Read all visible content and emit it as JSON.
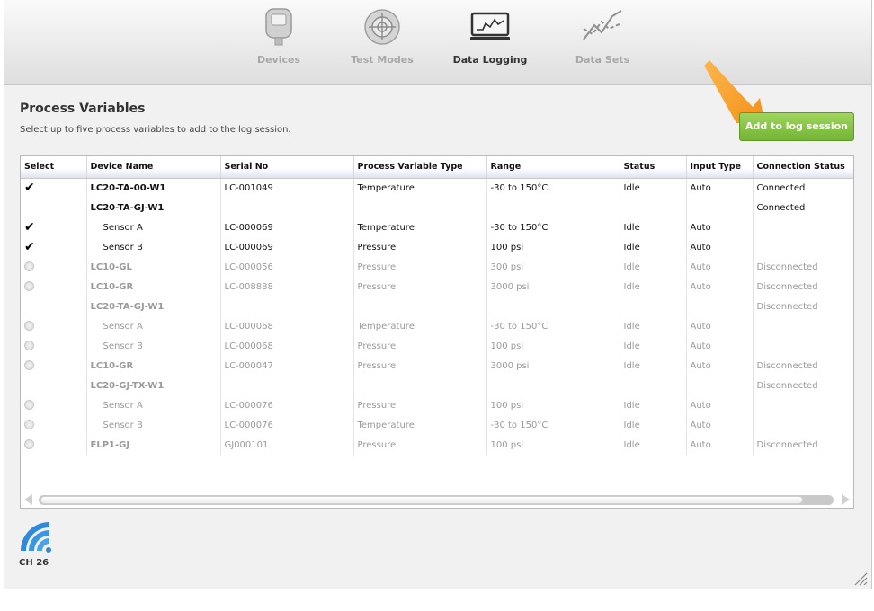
{
  "nav": {
    "items": [
      {
        "label": "Devices",
        "icon": "device-icon",
        "active": false
      },
      {
        "label": "Test Modes",
        "icon": "crosshair-icon",
        "active": false
      },
      {
        "label": "Data Logging",
        "icon": "monitor-chart-icon",
        "active": true
      },
      {
        "label": "Data Sets",
        "icon": "line-chart-icon",
        "active": false
      }
    ]
  },
  "main": {
    "title": "Process Variables",
    "subtitle": "Select up to five process variables to add to the log session.",
    "add_button": "Add to log session"
  },
  "table": {
    "headers": [
      "Select",
      "Device Name",
      "Serial No",
      "Process Variable Type",
      "Range",
      "Status",
      "Input Type",
      "Connection Status"
    ],
    "rows": [
      {
        "select": "check",
        "device": "LC20-TA-00-W1",
        "level": "device",
        "serial": "LC-001049",
        "type": "Temperature",
        "range": "-30 to 150°C",
        "status": "Idle",
        "input": "Auto",
        "conn": "Connected",
        "disabled": false
      },
      {
        "select": "none",
        "device": "LC20-TA-GJ-W1",
        "level": "device",
        "serial": "",
        "type": "",
        "range": "",
        "status": "",
        "input": "",
        "conn": "Connected",
        "disabled": false
      },
      {
        "select": "check",
        "device": "Sensor A",
        "level": "sensor",
        "serial": "LC-000069",
        "type": "Temperature",
        "range": "-30 to 150°C",
        "status": "Idle",
        "input": "Auto",
        "conn": "",
        "disabled": false
      },
      {
        "select": "check",
        "device": "Sensor B",
        "level": "sensor",
        "serial": "LC-000069",
        "type": "Pressure",
        "range": "100 psi",
        "status": "Idle",
        "input": "Auto",
        "conn": "",
        "disabled": false
      },
      {
        "select": "radio",
        "device": "LC10-GL",
        "level": "device",
        "serial": "LC-000056",
        "type": "Pressure",
        "range": "300 psi",
        "status": "Idle",
        "input": "Auto",
        "conn": "Disconnected",
        "disabled": true
      },
      {
        "select": "radio",
        "device": "LC10-GR",
        "level": "device",
        "serial": "LC-008888",
        "type": "Pressure",
        "range": "3000 psi",
        "status": "Idle",
        "input": "Auto",
        "conn": "Disconnected",
        "disabled": true
      },
      {
        "select": "none",
        "device": "LC20-TA-GJ-W1",
        "level": "device",
        "serial": "",
        "type": "",
        "range": "",
        "status": "",
        "input": "",
        "conn": "Disconnected",
        "disabled": true
      },
      {
        "select": "radio",
        "device": "Sensor A",
        "level": "sensor",
        "serial": "LC-000068",
        "type": "Temperature",
        "range": "-30 to 150°C",
        "status": "Idle",
        "input": "Auto",
        "conn": "",
        "disabled": true
      },
      {
        "select": "radio",
        "device": "Sensor B",
        "level": "sensor",
        "serial": "LC-000068",
        "type": "Pressure",
        "range": "100 psi",
        "status": "Idle",
        "input": "Auto",
        "conn": "",
        "disabled": true
      },
      {
        "select": "radio",
        "device": "LC10-GR",
        "level": "device",
        "serial": "LC-000047",
        "type": "Pressure",
        "range": "3000 psi",
        "status": "Idle",
        "input": "Auto",
        "conn": "Disconnected",
        "disabled": true
      },
      {
        "select": "none",
        "device": "LC20-GJ-TX-W1",
        "level": "device",
        "serial": "",
        "type": "",
        "range": "",
        "status": "",
        "input": "",
        "conn": "Disconnected",
        "disabled": true
      },
      {
        "select": "radio",
        "device": "Sensor A",
        "level": "sensor",
        "serial": "LC-000076",
        "type": "Pressure",
        "range": "100 psi",
        "status": "Idle",
        "input": "Auto",
        "conn": "",
        "disabled": true
      },
      {
        "select": "radio",
        "device": "Sensor B",
        "level": "sensor",
        "serial": "LC-000076",
        "type": "Temperature",
        "range": "-30 to 150°C",
        "status": "Idle",
        "input": "Auto",
        "conn": "",
        "disabled": true
      },
      {
        "select": "radio",
        "device": "FLP1-GJ",
        "level": "device",
        "serial": "GJ000101",
        "type": "Pressure",
        "range": "100 psi",
        "status": "Idle",
        "input": "Auto",
        "conn": "Disconnected",
        "disabled": true
      }
    ]
  },
  "footer": {
    "channel_label": "CH 26",
    "channel_icon": "wireless-signal-icon"
  },
  "colors": {
    "accent_green": "#7ab83b",
    "wireless_blue": "#2f8ad9",
    "arrow_orange": "#f6961e"
  }
}
